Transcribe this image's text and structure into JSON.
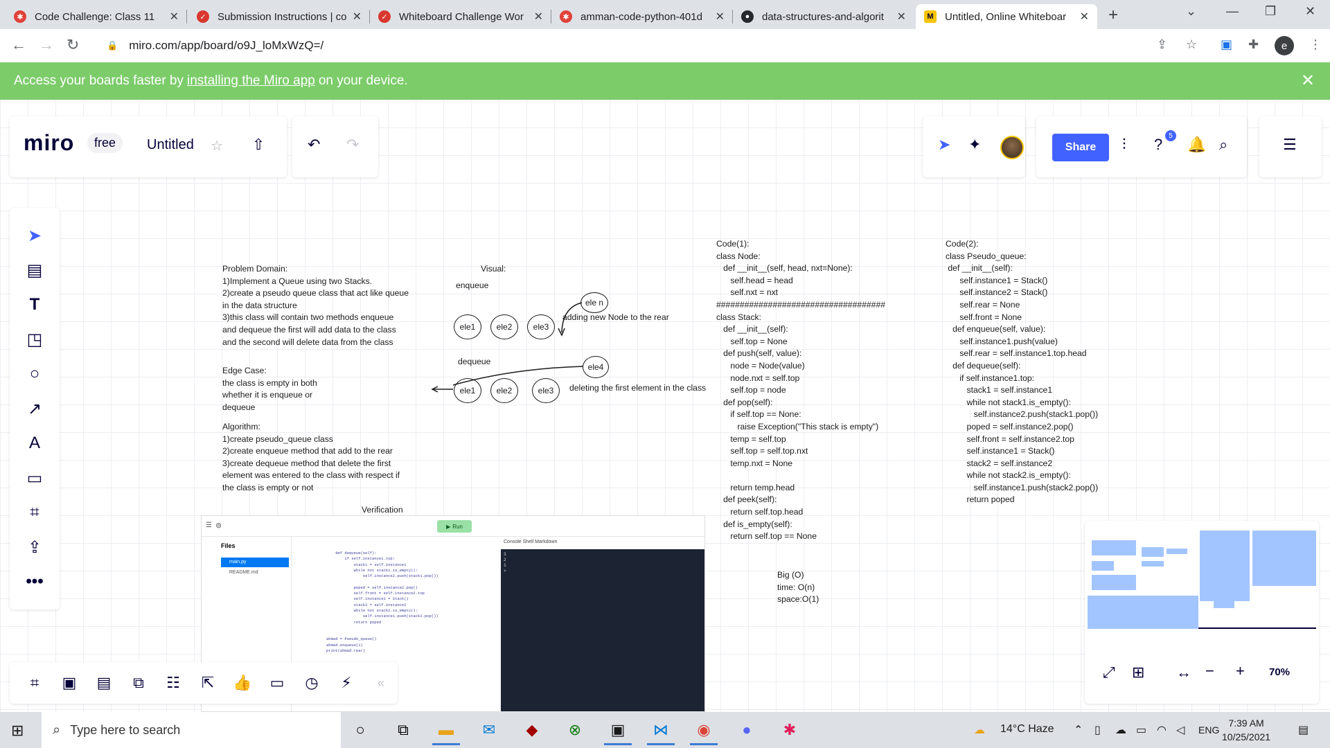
{
  "browser": {
    "tabs": [
      {
        "title": "Code Challenge: Class 11",
        "favicon_color": "#e0413a"
      },
      {
        "title": "Submission Instructions | co",
        "favicon_color": "#d8382f"
      },
      {
        "title": "Whiteboard Challenge Wor",
        "favicon_color": "#d8382f"
      },
      {
        "title": "amman-code-python-401d",
        "favicon_color": "#e0413a"
      },
      {
        "title": "data-structures-and-algorit",
        "favicon_color": "#24292e"
      },
      {
        "title": "Untitled, Online Whiteboar",
        "favicon_color": "#f5c400"
      }
    ],
    "url": "miro.com/app/board/o9J_loMxWzQ=/",
    "profile_initial": "e"
  },
  "banner": {
    "prefix": "Access your boards faster by",
    "link": "installing the Miro app",
    "suffix": "on your device."
  },
  "miro": {
    "logo": "miro",
    "plan": "free",
    "board_name": "Untitled",
    "share_label": "Share",
    "help_badge": "5",
    "zoom_level": "70%"
  },
  "board": {
    "problem_domain": "Problem Domain:\n1)Implement a Queue using two Stacks.\n2)create a pseudo queue class that act like queue\nin the data structure\n3)this class will contain two methods enqueue\nand dequeue the first will add data to the class\nand the second will delete data from the class",
    "edge_case": "Edge Case:\nthe class is empty in both\nwhether it is enqueue or\ndequeue",
    "algorithm": "Algorithm:\n1)create pseudo_queue class\n2)create enqueue method that add to the rear\n3)create dequeue method that delete the first\nelement was entered to the class with respect if\nthe class is empty or not",
    "visual_label": "Visual:",
    "enqueue_label": "enqueue",
    "dequeue_label": "dequeue",
    "verification_label": "Verification",
    "adding_note": "adding new Node to the rear",
    "deleting_note": "deleting the first element in the class",
    "enqueue_nodes": [
      "ele1",
      "ele2",
      "ele3"
    ],
    "new_node": "ele n",
    "dequeue_nodes": [
      "ele1",
      "ele2",
      "ele3"
    ],
    "dequeue_new_node": "ele4",
    "code1": "Code(1):\nclass Node:\n   def __init__(self, head, nxt=None):\n      self.head = head\n      self.nxt = nxt\n####################################\nclass Stack:\n   def __init__(self):\n      self.top = None\n   def push(self, value):\n      node = Node(value)\n      node.nxt = self.top\n      self.top = node\n   def pop(self):\n      if self.top == None:\n         raise Exception(\"This stack is empty\")\n      temp = self.top\n      self.top = self.top.nxt\n      temp.nxt = None\n\n      return temp.head\n   def peek(self):\n      return self.top.head\n   def is_empty(self):\n      return self.top == None",
    "code2": "Code(2):\nclass Pseudo_queue:\n def __init__(self):\n      self.instance1 = Stack()\n      self.instance2 = Stack()\n      self.rear = None\n      self.front = None\n   def enqueue(self, value):\n      self.instance1.push(value)\n      self.rear = self.instance1.top.head\n   def dequeue(self):\n      if self.instance1.top:\n         stack1 = self.instance1\n         while not stack1.is_empty():\n            self.instance2.push(stack1.pop())\n         poped = self.instance2.pop()\n         self.front = self.instance2.top\n         self.instance1 = Stack()\n         stack2 = self.instance2\n         while not stack2.is_empty():\n            self.instance1.push(stack2.pop())\n         return poped",
    "big_o": "Big (O)\ntime: O(n)\nspace:O(1)"
  },
  "replit": {
    "files_label": "Files",
    "selected_file": "main.py",
    "other_file": "README.md",
    "run_label": "Run",
    "console_tabs": "Console   Shell   Markdown",
    "editor_code": "    def dequeue(self):\n        if self.instance1.top:\n            stack1 = self.instance1\n            while not stack1.is_empty():\n                self.instance2.push(stack1.pop())\n\n            poped = self.instance2.pop()\n            self.front = self.instance2.top\n            self.instance1 = Stack()\n            stack2 = self.instance2\n            while not stack2.is_empty():\n                self.instance1.push(stack2.pop())\n            return poped\n\n\nahmad = Pseudo_queue()\nahmad.enqueue(1)\nprint(ahmad.rear)",
    "console_output": "3\n2\n1\n> "
  },
  "taskbar": {
    "search_placeholder": "Type here to search",
    "weather": "14°C  Haze",
    "lang": "ENG",
    "time": "7:39 AM",
    "date": "10/25/2021"
  }
}
